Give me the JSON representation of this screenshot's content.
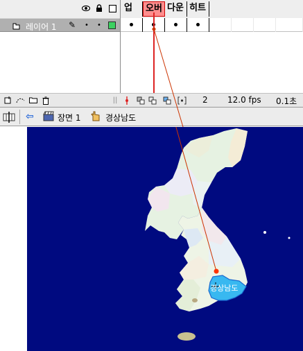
{
  "timeline": {
    "header_icons": [
      "eye-icon",
      "lock-icon",
      "outline-icon"
    ],
    "frame_headers": [
      {
        "label": "업",
        "active": false
      },
      {
        "label": "오버",
        "active": true
      },
      {
        "label": "다운",
        "active": false
      },
      {
        "label": "히트",
        "active": false
      }
    ],
    "layer": {
      "name": "레이어 1",
      "outline_color": "#3cd060",
      "keyframes": 4
    },
    "footer": {
      "current_frame": "2",
      "fps": "12.0 fps",
      "elapsed": "0.1초"
    },
    "playhead_color": "#dd2222"
  },
  "edit_bar": {
    "scene_label": "장면 1",
    "symbol_label": "경상남도"
  },
  "stage": {
    "background": "#000a80",
    "highlight_region_label": "경상남도",
    "highlight_color": "#38b8f0",
    "onion_line_color": "#cc3300"
  }
}
